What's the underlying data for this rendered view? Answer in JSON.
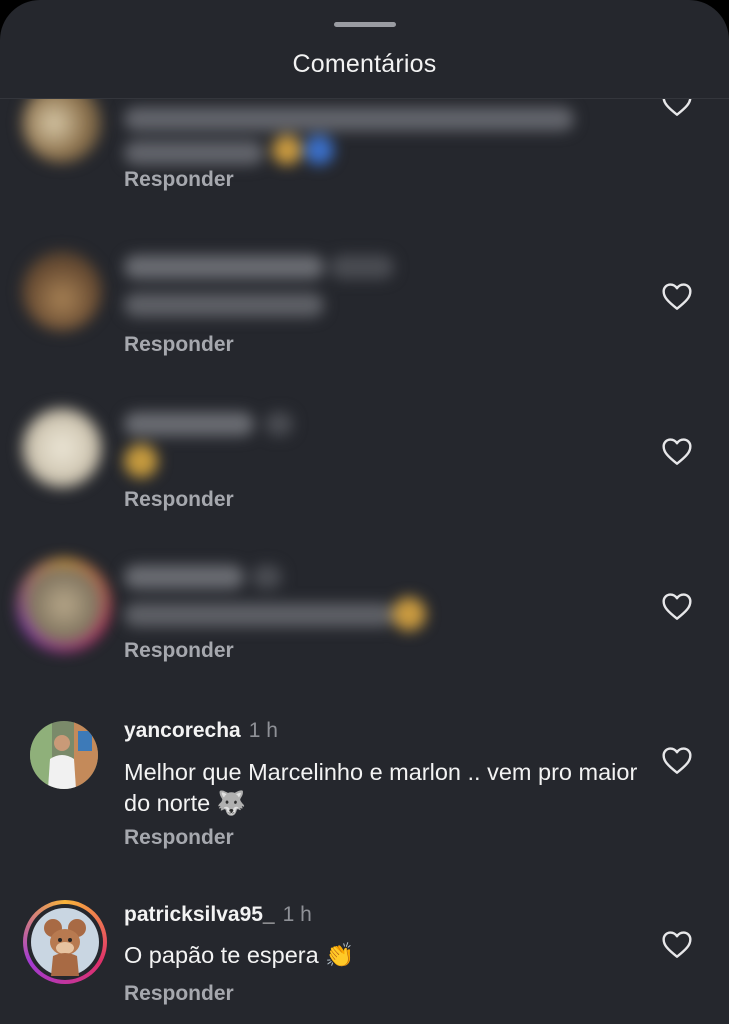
{
  "header": {
    "title": "Comentários"
  },
  "comments": [
    {
      "username": "",
      "time": "",
      "text": "",
      "reply_label": "Responder",
      "blurred": true
    },
    {
      "username": "",
      "time": "",
      "text": "",
      "reply_label": "Responder",
      "blurred": true
    },
    {
      "username": "",
      "time": "",
      "text": "",
      "reply_label": "Responder",
      "blurred": true
    },
    {
      "username": "",
      "time": "",
      "text": "",
      "reply_label": "Responder",
      "blurred": true
    },
    {
      "username": "yancorecha",
      "time": "1 h",
      "text": "Melhor que Marcelinho e marlon .. vem pro maior do norte 🐺",
      "reply_label": "Responder",
      "blurred": false
    },
    {
      "username": "patricksilva95_",
      "time": "1 h",
      "text": "O papão te espera 👏",
      "reply_label": "Responder",
      "blurred": false
    }
  ],
  "icons": {
    "like": "heart-outline-icon"
  },
  "colors": {
    "background": "#25272d",
    "text": "#f3f3f3",
    "muted": "#8f9197",
    "story_ring": [
      "#f9b43a",
      "#e0306b",
      "#a23ad2"
    ]
  }
}
